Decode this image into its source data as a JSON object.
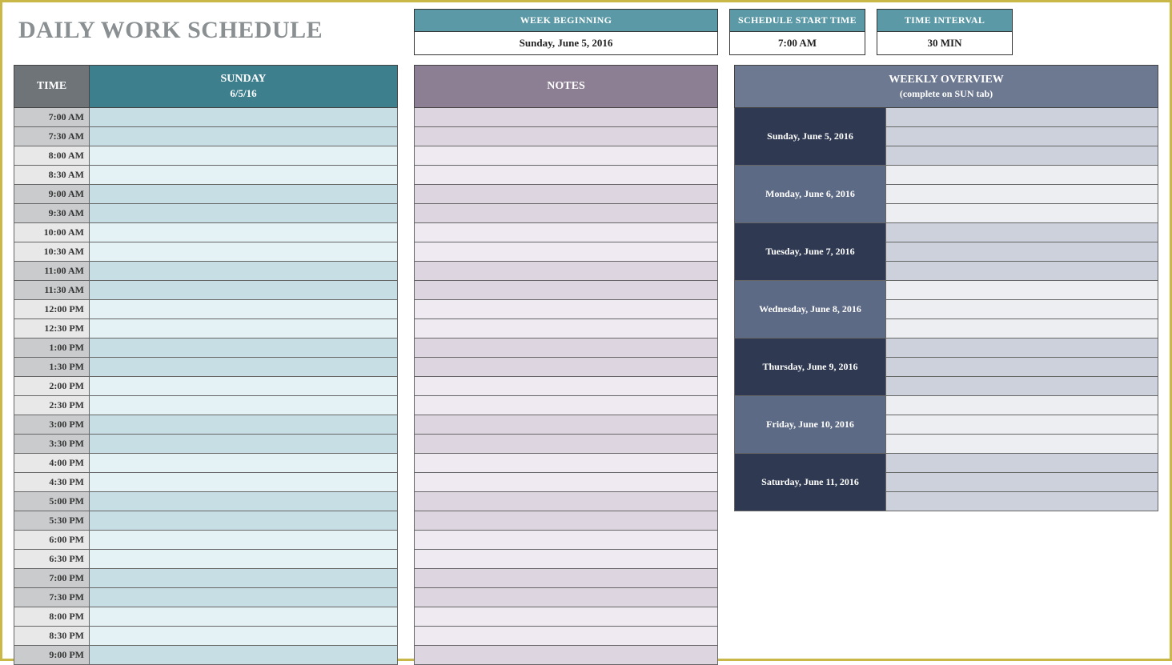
{
  "title": "DAILY WORK SCHEDULE",
  "meta": {
    "week_label": "WEEK BEGINNING",
    "week_value": "Sunday, June 5, 2016",
    "start_label": "SCHEDULE START TIME",
    "start_value": "7:00 AM",
    "interval_label": "TIME INTERVAL",
    "interval_value": "30 MIN"
  },
  "schedule": {
    "time_header": "TIME",
    "day_header": "SUNDAY",
    "day_sub": "6/5/16",
    "times": [
      "7:00 AM",
      "7:30 AM",
      "8:00 AM",
      "8:30 AM",
      "9:00 AM",
      "9:30 AM",
      "10:00 AM",
      "10:30 AM",
      "11:00 AM",
      "11:30 AM",
      "12:00 PM",
      "12:30 PM",
      "1:00 PM",
      "1:30 PM",
      "2:00 PM",
      "2:30 PM",
      "3:00 PM",
      "3:30 PM",
      "4:00 PM",
      "4:30 PM",
      "5:00 PM",
      "5:30 PM",
      "6:00 PM",
      "6:30 PM",
      "7:00 PM",
      "7:30 PM",
      "8:00 PM",
      "8:30 PM",
      "9:00 PM"
    ]
  },
  "notes": {
    "header": "NOTES",
    "rows": 29
  },
  "overview": {
    "header": "WEEKLY OVERVIEW",
    "sub": "(complete on SUN tab)",
    "days": [
      "Sunday, June 5, 2016",
      "Monday, June 6, 2016",
      "Tuesday, June 7, 2016",
      "Wednesday, June 8, 2016",
      "Thursday, June 9, 2016",
      "Friday, June 10, 2016",
      "Saturday, June 11, 2016"
    ]
  }
}
